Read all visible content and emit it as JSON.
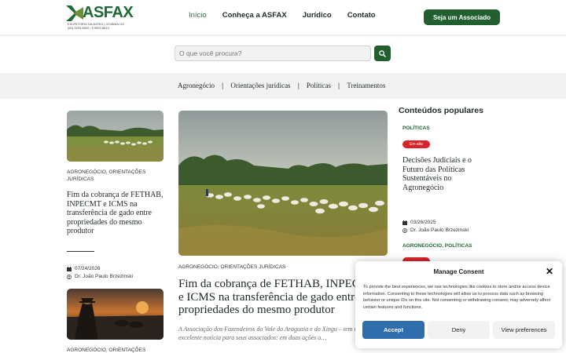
{
  "header": {
    "logo_text": "ASFAX",
    "logo_sub_1": "ESCRITÓRIO DA ASFAX | GOIÂNIA GO",
    "logo_sub_2": "(62) 3293 5820 / 9 9903 8819",
    "nav": [
      {
        "label": "Início",
        "active": true
      },
      {
        "label": "Conheça a ASFAX",
        "active": false
      },
      {
        "label": "Jurídico",
        "active": false
      },
      {
        "label": "Contato",
        "active": false
      }
    ],
    "cta_label": "Seja um Associado"
  },
  "search": {
    "placeholder": "O que você procura?"
  },
  "categories": [
    "Agronegócio",
    "Orientações jurídicas",
    "Políticas",
    "Treinamentos"
  ],
  "left_post": {
    "tags": "AGRONEGÓCIO, ORIENTAÇÕES JURÍDICAS",
    "title": "Fim da cobrança de FETHAB, INPECMT e ICMS na transferência de gado entre propriedades do mesmo produtor",
    "date": "07/24/2026",
    "author": "Dr. João Paulo Brzezinski"
  },
  "left_post_2": {
    "tags": "AGRONEGÓCIO, ORIENTAÇÕES"
  },
  "main_post": {
    "tags": "AGRONEGÓCIO, ORIENTAÇÕES JURÍDICAS",
    "title": "Fim da cobrança de FETHAB, INPECMT e ICMS na transferência de gado entre propriedades do mesmo produtor",
    "excerpt": "A Associação dos Fazendeiros do Vale do Araguaia e do Xingu – tem uma excelente notícia para seus associados: em duas ações o…"
  },
  "popular": {
    "heading": "Conteúdos populares",
    "item1": {
      "category": "POLÍTICAS",
      "badge": "Em alta",
      "title": "Decisões Judiciais e o Futuro das Políticas Sustentáveis no Agronegócio",
      "date": "03/26/2025",
      "author": "Dr. João Paulo Brzezinski"
    },
    "item2": {
      "category": "AGRONEGÓCIO, POLÍTICAS"
    }
  },
  "cookie": {
    "title": "Manage Consent",
    "text": "To provide the best experiences, we use technologies like cookies to store and/or access device information. Consenting to these technologies will allow us to process data such as browsing behavior or unique IDs on this site. Not consenting or withdrawing consent, may adversely affect certain features and functions.",
    "accept": "Accept",
    "deny": "Deny",
    "preferences": "View preferences"
  },
  "colors": {
    "brand_green": "#215f30",
    "accent_red": "#d8232a",
    "accept_blue": "#2e6ead"
  },
  "icons": [
    "search-icon",
    "calendar-icon",
    "user-icon",
    "close-icon"
  ]
}
